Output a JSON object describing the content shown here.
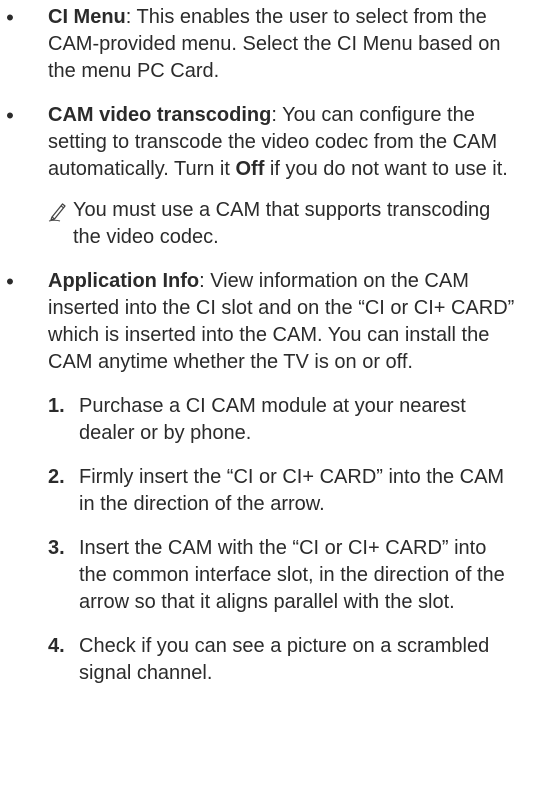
{
  "items": [
    {
      "term": "CI Menu",
      "text": ": This enables the user to select from the CAM-provided menu. Select the CI Menu based on the menu PC Card."
    },
    {
      "term": "CAM video transcoding",
      "text_before": ": You can configure the setting to transcode the video codec from the CAM automatically. Turn it ",
      "bold": "Off",
      "text_after": " if you do not want to use it.",
      "note": "You must use a CAM that supports transcoding the video codec."
    },
    {
      "term": "Application Info",
      "text": ": View information on the CAM inserted into the CI slot and on the “CI or CI+ CARD” which is inserted into the CAM. You can install the CAM anytime whether the TV is on or off.",
      "steps": [
        {
          "num": "1.",
          "text": "Purchase a CI CAM module at your nearest dealer or by phone."
        },
        {
          "num": "2.",
          "text": "Firmly insert the “CI or CI+ CARD” into the CAM in the direction of the arrow."
        },
        {
          "num": "3.",
          "text": "Insert the CAM with the “CI or CI+ CARD” into the common interface slot, in the direction of the arrow so that it aligns parallel with the slot."
        },
        {
          "num": "4.",
          "text": "Check if you can see a picture on a scrambled signal channel."
        }
      ]
    }
  ],
  "bullet_char": "•",
  "icons": {
    "note": "pencil-note-icon"
  }
}
